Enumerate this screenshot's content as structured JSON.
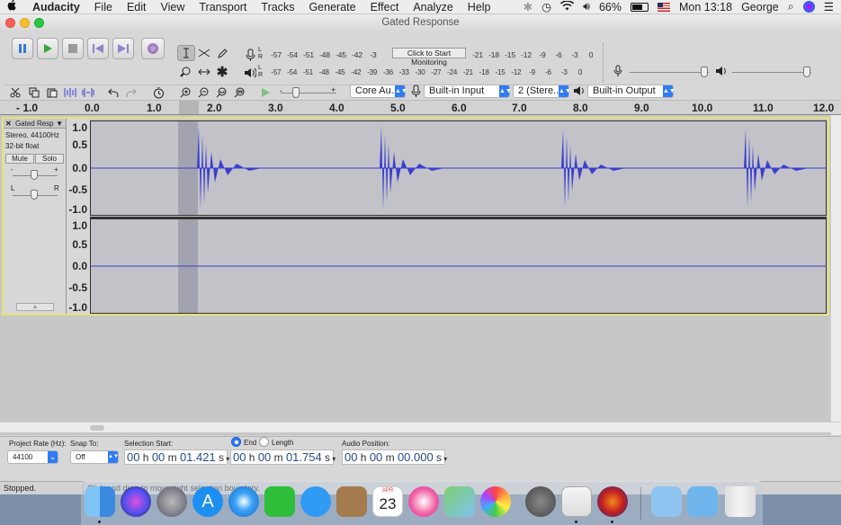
{
  "menubar": {
    "apple": "",
    "app_name": "Audacity",
    "items": [
      "File",
      "Edit",
      "View",
      "Transport",
      "Tracks",
      "Generate",
      "Effect",
      "Analyze",
      "Help"
    ],
    "battery": "66%",
    "clock": "Mon 13:18",
    "user": "George"
  },
  "window": {
    "title": "Gated Response"
  },
  "meters": {
    "record_scale": [
      "-57",
      "-54",
      "-51",
      "-48",
      "-45",
      "-42",
      "-3"
    ],
    "monitor_label": "Click to Start Monitoring",
    "record_scale_right": [
      "-21",
      "-18",
      "-15",
      "-12",
      "-9",
      "-6",
      "-3",
      "0"
    ],
    "play_scale": [
      "-57",
      "-54",
      "-51",
      "-48",
      "-45",
      "-42",
      "-39",
      "-36",
      "-33",
      "-30",
      "-27",
      "-24",
      "-21",
      "-18",
      "-15",
      "-12",
      "-9",
      "-6",
      "-3",
      "0"
    ],
    "L": "L",
    "R": "R"
  },
  "device": {
    "host": "Core Au...",
    "input": "Built-in Input",
    "channels": "2 (Stere...",
    "output": "Built-in Output"
  },
  "ruler": {
    "ticks": [
      "- 1.0",
      "0.0",
      "1.0",
      "2.0",
      "3.0",
      "4.0",
      "5.0",
      "6.0",
      "7.0",
      "8.0",
      "9.0",
      "10.0",
      "11.0",
      "12.0"
    ]
  },
  "track": {
    "name": "Gated Resp",
    "info1": "Stereo, 44100Hz",
    "info2": "32-bit float",
    "mute": "Mute",
    "solo": "Solo",
    "gain_minus": "-",
    "gain_plus": "+",
    "pan_l": "L",
    "pan_r": "R",
    "scale_top": [
      "1.0",
      "0.5",
      "0.0",
      "-0.5",
      "-1.0"
    ],
    "scale_bottom": [
      "1.0",
      "0.5",
      "0.0",
      "-0.5",
      "-1.0"
    ]
  },
  "bottom": {
    "rate_label": "Project Rate (Hz):",
    "rate_value": "44100",
    "snap_label": "Snap To:",
    "snap_value": "Off",
    "sel_start_label": "Selection Start:",
    "end_label": "End",
    "length_label": "Length",
    "audio_pos_label": "Audio Position:",
    "sel_start": {
      "h": "00",
      "hl": " h ",
      "m": "00",
      "ml": " m ",
      "s": "01.421",
      "sl": " s"
    },
    "sel_end": {
      "h": "00",
      "hl": " h ",
      "m": "00",
      "ml": " m ",
      "s": "01.754",
      "sl": " s"
    },
    "audio_pos": {
      "h": "00",
      "hl": " h ",
      "m": "00",
      "ml": " m ",
      "s": "00.000",
      "sl": " s"
    }
  },
  "status": {
    "state": "Stopped.",
    "hint": "Click and drag to move right selection boundary."
  },
  "dock": {
    "calendar_month": "APR",
    "calendar_day": "23"
  },
  "colors": {
    "waveform": "#3b3fd0",
    "selection": "#a3a3b0",
    "accent": "#2f7cf6"
  }
}
